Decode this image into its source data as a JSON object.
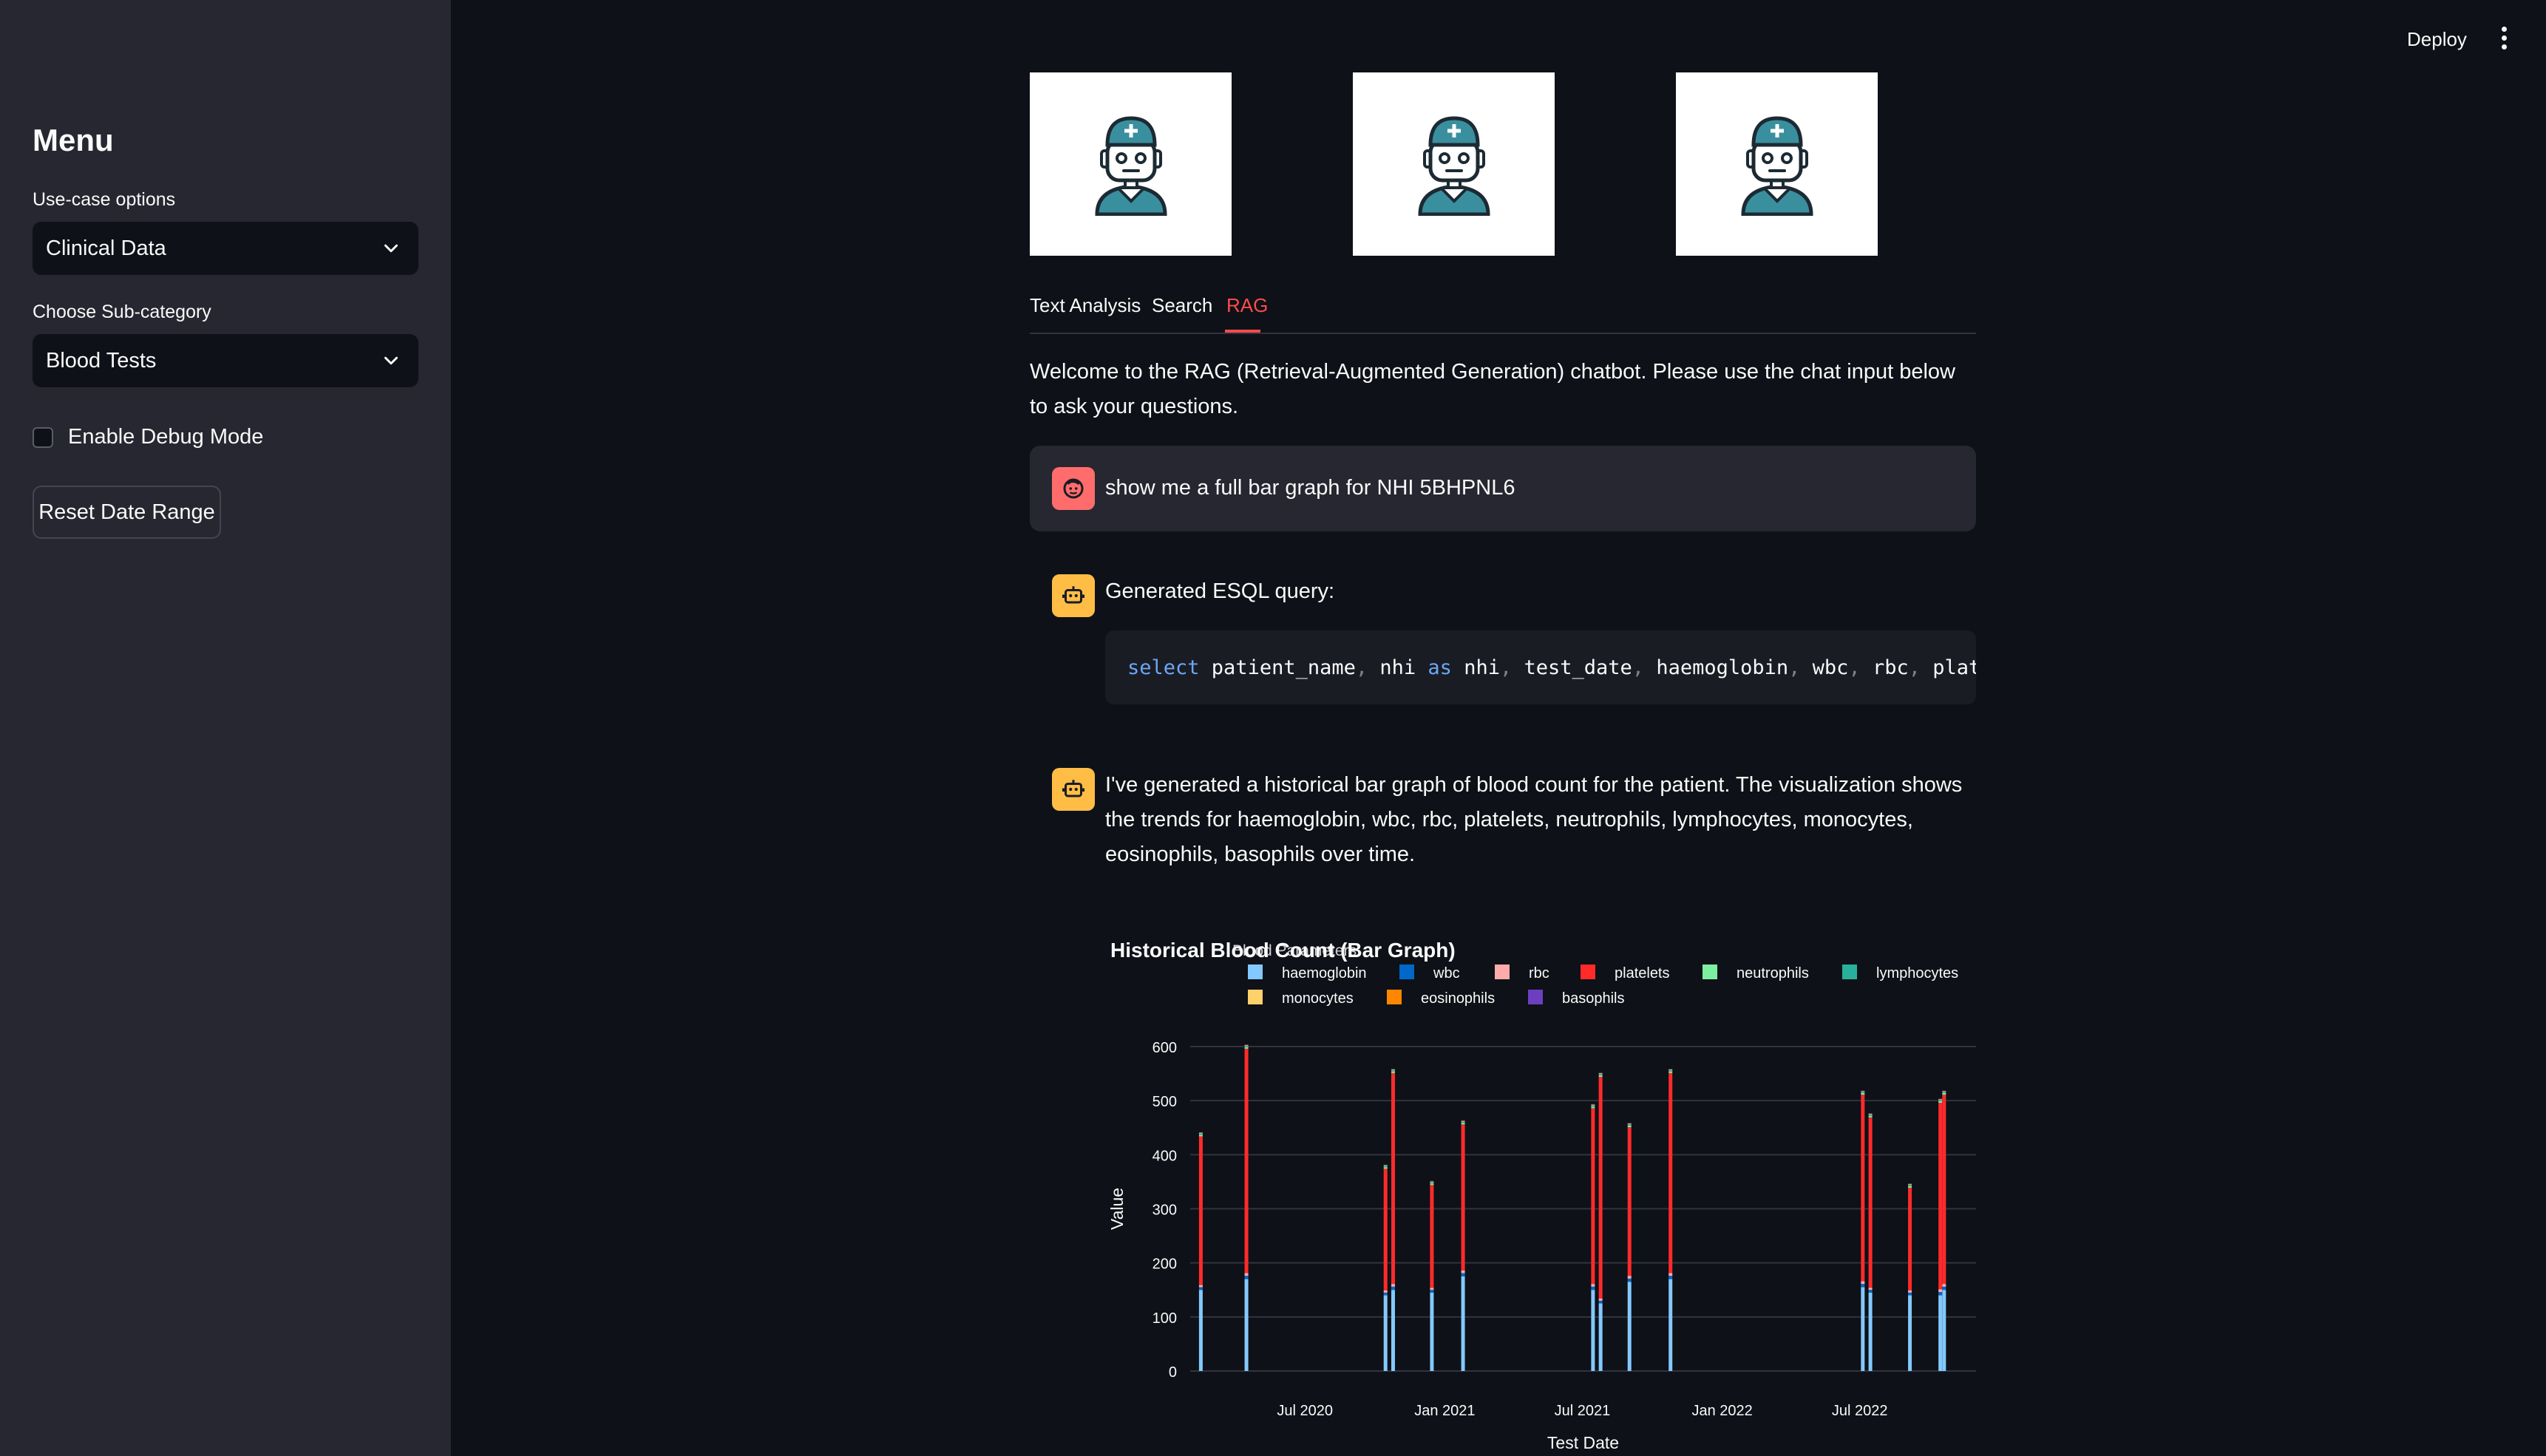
{
  "header": {
    "deploy_label": "Deploy",
    "menu_icon": "kebab-menu-icon"
  },
  "sidebar": {
    "title": "Menu",
    "usecase_label": "Use-case options",
    "usecase_value": "Clinical Data",
    "subcategory_label": "Choose Sub-category",
    "subcategory_value": "Blood Tests",
    "debug_label": "Enable Debug Mode",
    "debug_checked": false,
    "reset_label": "Reset Date Range"
  },
  "main": {
    "avatars": [
      "doctor-robot-icon",
      "doctor-robot-icon",
      "doctor-robot-icon"
    ],
    "tabs": [
      {
        "label": "Text Analysis",
        "active": false
      },
      {
        "label": "Search",
        "active": false
      },
      {
        "label": "RAG",
        "active": true
      }
    ],
    "welcome": "Welcome to the RAG (Retrieval-Augmented Generation) chatbot. Please use the chat input below to ask your questions.",
    "messages": [
      {
        "role": "user",
        "text": "show me a full bar graph for NHI 5BHPNL6"
      },
      {
        "role": "assistant",
        "text": "Generated ESQL query:"
      },
      {
        "role": "assistant",
        "text": "I've generated a historical bar graph of blood count for the patient. The visualization shows the trends for haemoglobin, wbc, rbc, platelets, neutrophils, lymphocytes, monocytes, eosinophils, basophils over time."
      }
    ],
    "code": {
      "tokens": [
        {
          "t": "select",
          "k": "kw"
        },
        {
          "t": " patient_name",
          "k": "id"
        },
        {
          "t": ",",
          "k": "p"
        },
        {
          "t": " nhi ",
          "k": "id"
        },
        {
          "t": "as",
          "k": "kw"
        },
        {
          "t": " nhi",
          "k": "id"
        },
        {
          "t": ",",
          "k": "p"
        },
        {
          "t": " test_date",
          "k": "id"
        },
        {
          "t": ",",
          "k": "p"
        },
        {
          "t": " haemoglobin",
          "k": "id"
        },
        {
          "t": ",",
          "k": "p"
        },
        {
          "t": " wbc",
          "k": "id"
        },
        {
          "t": ",",
          "k": "p"
        },
        {
          "t": " rbc",
          "k": "id"
        },
        {
          "t": ",",
          "k": "p"
        },
        {
          "t": " platelets",
          "k": "id"
        }
      ]
    }
  },
  "colors": {
    "accent": "#ff4b4b",
    "haemoglobin": "#83c9ff",
    "wbc": "#0068c9",
    "rbc": "#ffabab",
    "platelets": "#ff2b2b",
    "neutrophils": "#7defa1",
    "lymphocytes": "#29b09d",
    "monocytes": "#ffd16a",
    "eosinophils": "#ff8700",
    "basophils": "#6d3fc0"
  },
  "chart_data": {
    "type": "bar",
    "title": "Historical Blood Count (Bar Graph)",
    "legend_title": "Blood Parameters",
    "legend_position": "top",
    "xlabel": "Test Date",
    "ylabel": "Value",
    "ylim": [
      0,
      600
    ],
    "yticks": [
      0,
      100,
      200,
      300,
      400,
      500,
      600
    ],
    "xticks": [
      {
        "date": "2020-07-01",
        "label": "Jul 2020"
      },
      {
        "date": "2021-01-01",
        "label": "Jan 2021"
      },
      {
        "date": "2021-07-01",
        "label": "Jul 2021"
      },
      {
        "date": "2022-01-01",
        "label": "Jan 2022"
      },
      {
        "date": "2022-07-01",
        "label": "Jul 2022"
      }
    ],
    "xrange": [
      "2020-02-01",
      "2022-12-01"
    ],
    "grid": true,
    "barmode": "stack",
    "series_names": [
      "haemoglobin",
      "wbc",
      "rbc",
      "platelets",
      "neutrophils",
      "lymphocytes",
      "monocytes",
      "eosinophils",
      "basophils"
    ],
    "points": [
      {
        "date": "2020-02-15",
        "haemoglobin": 150,
        "wbc": 5,
        "rbc": 4,
        "platelets": 275,
        "neutrophils": 3,
        "lymphocytes": 2,
        "monocytes": 1,
        "eosinophils": 0.5,
        "basophils": 0.2
      },
      {
        "date": "2020-04-15",
        "haemoglobin": 170,
        "wbc": 6,
        "rbc": 5,
        "platelets": 415,
        "neutrophils": 3,
        "lymphocytes": 2,
        "monocytes": 1,
        "eosinophils": 0.5,
        "basophils": 0.2
      },
      {
        "date": "2020-10-15",
        "haemoglobin": 140,
        "wbc": 5,
        "rbc": 4,
        "platelets": 225,
        "neutrophils": 3,
        "lymphocytes": 2,
        "monocytes": 1,
        "eosinophils": 0.5,
        "basophils": 0.2
      },
      {
        "date": "2020-10-25",
        "haemoglobin": 150,
        "wbc": 6,
        "rbc": 5,
        "platelets": 390,
        "neutrophils": 3,
        "lymphocytes": 2,
        "monocytes": 1,
        "eosinophils": 0.5,
        "basophils": 0.2
      },
      {
        "date": "2020-12-15",
        "haemoglobin": 145,
        "wbc": 5,
        "rbc": 4,
        "platelets": 190,
        "neutrophils": 3,
        "lymphocytes": 2,
        "monocytes": 1,
        "eosinophils": 0.5,
        "basophils": 0.2
      },
      {
        "date": "2021-01-25",
        "haemoglobin": 175,
        "wbc": 6,
        "rbc": 5,
        "platelets": 270,
        "neutrophils": 3,
        "lymphocytes": 2,
        "monocytes": 1,
        "eosinophils": 0.5,
        "basophils": 0.2
      },
      {
        "date": "2021-07-15",
        "haemoglobin": 150,
        "wbc": 6,
        "rbc": 5,
        "platelets": 325,
        "neutrophils": 3,
        "lymphocytes": 2,
        "monocytes": 1,
        "eosinophils": 0.5,
        "basophils": 0.2
      },
      {
        "date": "2021-07-25",
        "haemoglobin": 125,
        "wbc": 5,
        "rbc": 4,
        "platelets": 410,
        "neutrophils": 3,
        "lymphocytes": 2,
        "monocytes": 1,
        "eosinophils": 0.5,
        "basophils": 0.2
      },
      {
        "date": "2021-09-01",
        "haemoglobin": 165,
        "wbc": 6,
        "rbc": 5,
        "platelets": 275,
        "neutrophils": 3,
        "lymphocytes": 2,
        "monocytes": 1,
        "eosinophils": 0.5,
        "basophils": 0.2
      },
      {
        "date": "2021-10-25",
        "haemoglobin": 170,
        "wbc": 6,
        "rbc": 5,
        "platelets": 370,
        "neutrophils": 3,
        "lymphocytes": 2,
        "monocytes": 1,
        "eosinophils": 0.5,
        "basophils": 0.2
      },
      {
        "date": "2022-07-05",
        "haemoglobin": 155,
        "wbc": 6,
        "rbc": 5,
        "platelets": 345,
        "neutrophils": 3,
        "lymphocytes": 2,
        "monocytes": 1,
        "eosinophils": 0.5,
        "basophils": 0.2
      },
      {
        "date": "2022-07-15",
        "haemoglobin": 145,
        "wbc": 5,
        "rbc": 4,
        "platelets": 315,
        "neutrophils": 3,
        "lymphocytes": 2,
        "monocytes": 1,
        "eosinophils": 0.5,
        "basophils": 0.2
      },
      {
        "date": "2022-09-05",
        "haemoglobin": 140,
        "wbc": 5,
        "rbc": 4,
        "platelets": 190,
        "neutrophils": 3,
        "lymphocytes": 2,
        "monocytes": 1,
        "eosinophils": 0.5,
        "basophils": 0.2
      },
      {
        "date": "2022-10-15",
        "haemoglobin": 140,
        "wbc": 6,
        "rbc": 5,
        "platelets": 345,
        "neutrophils": 3,
        "lymphocytes": 2,
        "monocytes": 1,
        "eosinophils": 0.5,
        "basophils": 0.2
      },
      {
        "date": "2022-10-20",
        "haemoglobin": 150,
        "wbc": 6,
        "rbc": 5,
        "platelets": 350,
        "neutrophils": 3,
        "lymphocytes": 2,
        "monocytes": 1,
        "eosinophils": 0.5,
        "basophils": 0.2
      }
    ]
  }
}
